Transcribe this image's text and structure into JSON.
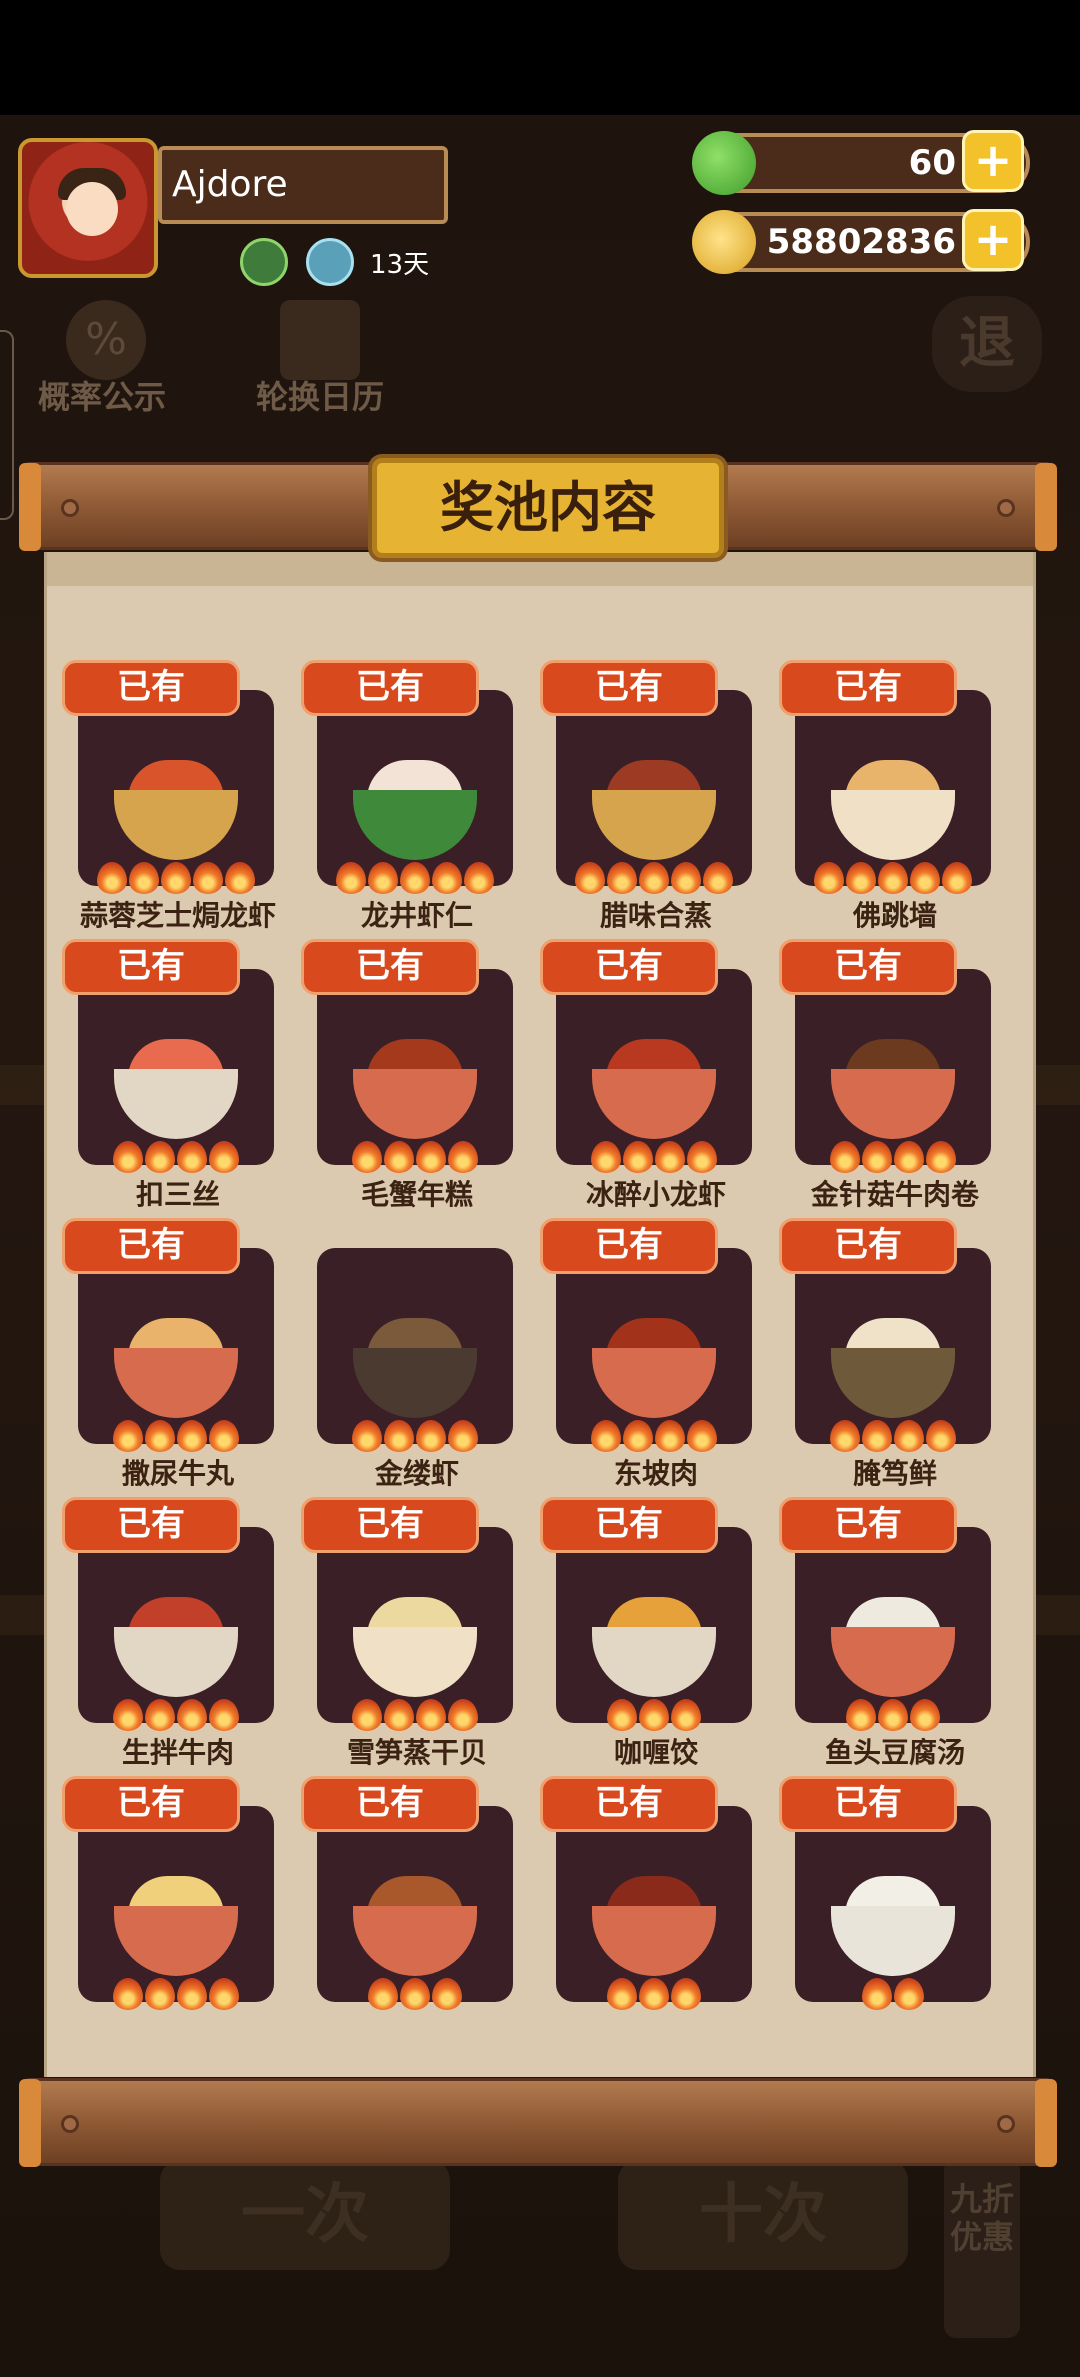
{
  "player": {
    "name": "Ajdore",
    "days": "13天"
  },
  "resources": {
    "gems": "60",
    "coins": "58802836",
    "plus": "+"
  },
  "background_buttons": {
    "probability": "概率公示",
    "probability_icon": "%",
    "calendar": "轮换日历",
    "exit": "退",
    "single_draw": "一次",
    "ten_draw": "十次",
    "discount": "九折优惠"
  },
  "panel": {
    "title": "奖池内容",
    "owned_label": "已有",
    "dishes": [
      {
        "name": "蒜蓉芝士焗龙虾",
        "owned": true,
        "flames": 5,
        "food": "#d9542b",
        "plate": "#d6a44c"
      },
      {
        "name": "龙井虾仁",
        "owned": true,
        "flames": 5,
        "food": "#f3e2d6",
        "plate": "#3f8a3a"
      },
      {
        "name": "腊味合蒸",
        "owned": true,
        "flames": 5,
        "food": "#9c3a24",
        "plate": "#d6a44c"
      },
      {
        "name": "佛跳墙",
        "owned": true,
        "flames": 5,
        "food": "#e8b36b",
        "plate": "#efe0c6"
      },
      {
        "name": "扣三丝",
        "owned": true,
        "flames": 4,
        "food": "#e96b4f",
        "plate": "#e2d6c4"
      },
      {
        "name": "毛蟹年糕",
        "owned": true,
        "flames": 4,
        "food": "#a5391c",
        "plate": "#d66b4e"
      },
      {
        "name": "冰醉小龙虾",
        "owned": true,
        "flames": 4,
        "food": "#b8391f",
        "plate": "#d66b4e"
      },
      {
        "name": "金针菇牛肉卷",
        "owned": true,
        "flames": 4,
        "food": "#6b3a1f",
        "plate": "#d66b4e"
      },
      {
        "name": "撒尿牛丸",
        "owned": true,
        "flames": 4,
        "food": "#e9b36b",
        "plate": "#d66b4e"
      },
      {
        "name": "金缕虾",
        "owned": false,
        "flames": 4,
        "food": "#7a5a3a",
        "plate": "#4a3a30"
      },
      {
        "name": "东坡肉",
        "owned": true,
        "flames": 4,
        "food": "#a3321a",
        "plate": "#d66b4e"
      },
      {
        "name": "腌笃鲜",
        "owned": true,
        "flames": 4,
        "food": "#efe2c9",
        "plate": "#6e5a3a"
      },
      {
        "name": "生拌牛肉",
        "owned": true,
        "flames": 4,
        "food": "#c2402a",
        "plate": "#e2d6c4"
      },
      {
        "name": "雪笋蒸干贝",
        "owned": true,
        "flames": 4,
        "food": "#ecd9a0",
        "plate": "#efe0c6"
      },
      {
        "name": "咖喱饺",
        "owned": true,
        "flames": 3,
        "food": "#e6a13a",
        "plate": "#e2d6c4"
      },
      {
        "name": "鱼头豆腐汤",
        "owned": true,
        "flames": 3,
        "food": "#efeadf",
        "plate": "#d66b4e"
      },
      {
        "name": "",
        "owned": true,
        "flames": 4,
        "food": "#f0d07a",
        "plate": "#d66b4e"
      },
      {
        "name": "",
        "owned": true,
        "flames": 3,
        "food": "#a8582a",
        "plate": "#d66b4e"
      },
      {
        "name": "",
        "owned": true,
        "flames": 3,
        "food": "#8a2a1a",
        "plate": "#d66b4e"
      },
      {
        "name": "",
        "owned": true,
        "flames": 2,
        "food": "#f2f0e6",
        "plate": "#e8e4da"
      }
    ]
  }
}
